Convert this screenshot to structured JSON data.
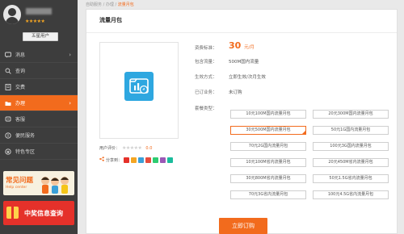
{
  "profile": {
    "level_badge": "五星用户"
  },
  "nav": {
    "items": [
      {
        "label": "消息",
        "icon": "message-icon"
      },
      {
        "label": "查询",
        "icon": "search-icon"
      },
      {
        "label": "交费",
        "icon": "payment-icon"
      },
      {
        "label": "办理",
        "icon": "handle-icon",
        "active": true
      },
      {
        "label": "客服",
        "icon": "service-icon"
      },
      {
        "label": "便民服务",
        "icon": "convenience-icon"
      },
      {
        "label": "特色专区",
        "icon": "feature-icon"
      }
    ]
  },
  "promos": {
    "help": {
      "title": "常见问题",
      "subtitle": "Help center"
    },
    "lottery": {
      "title": "中奖信息查询"
    }
  },
  "breadcrumb": {
    "home": "自助服务",
    "sep": "/",
    "level1": "办理",
    "current": "流量月包"
  },
  "panel": {
    "title": "流量月包"
  },
  "product": {
    "rating_label": "用户评价：",
    "rating_score": "0.0",
    "share_label": "分享到："
  },
  "details": {
    "fee_label": "资费标准：",
    "fee_value": "30",
    "fee_unit": "元/月",
    "content_label": "包含流量：",
    "content_value": "500M国内流量",
    "effect_label": "生效方式：",
    "effect_value": "立即生效/次月生效",
    "subscribed_label": "已订业务：",
    "subscribed_value": "未订购",
    "package_label": "套餐类型："
  },
  "packages": [
    "10元100M国内流量月包",
    "20元300M国内流量月包",
    "30元500M国内流量月包",
    "50元1G国内流量月包",
    "70元2G国内流量月包",
    "100元3G国内流量月包",
    "10元100M省内流量月包",
    "20元450M省内流量月包",
    "30元800M省内流量月包",
    "50元1.5G省内流量月包",
    "70元3G省内流量月包",
    "100元4.5G省内流量月包"
  ],
  "selected_package": 2,
  "order_button": "立即订购",
  "colors": {
    "accent": "#f26b1d",
    "sidebar": "#3d3d3d",
    "product_icon": "#2ea7e0"
  }
}
